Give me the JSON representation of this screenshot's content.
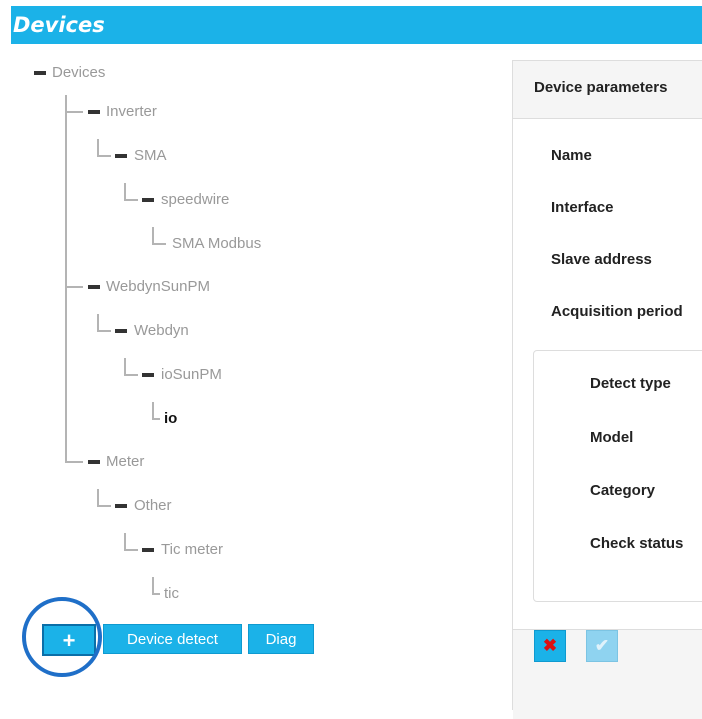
{
  "header": {
    "title": "Devices"
  },
  "tree": {
    "root": "Devices",
    "inverter": "Inverter",
    "sma": "SMA",
    "speedwire": "speedwire",
    "sma_modbus": "SMA Modbus",
    "webdynsunpm": "WebdynSunPM",
    "webdyn": "Webdyn",
    "iosunpm": "ioSunPM",
    "io": "io",
    "meter": "Meter",
    "other": "Other",
    "tic_meter": "Tic meter",
    "tic": "tic",
    "selected": "io"
  },
  "buttons": {
    "add": "+",
    "device_detect": "Device detect",
    "diag": "Diag"
  },
  "panel": {
    "title": "Device parameters",
    "fields": [
      "Name",
      "Interface",
      "Slave address",
      "Acquisition period"
    ],
    "detect_fields": [
      "Detect type",
      "Model",
      "Category",
      "Check status"
    ],
    "cancel": "✖",
    "ok": "✔"
  },
  "colors": {
    "accent": "#1bb2e8",
    "highlight_circle": "#1f6fc8",
    "cancel_icon": "#dd1111"
  }
}
